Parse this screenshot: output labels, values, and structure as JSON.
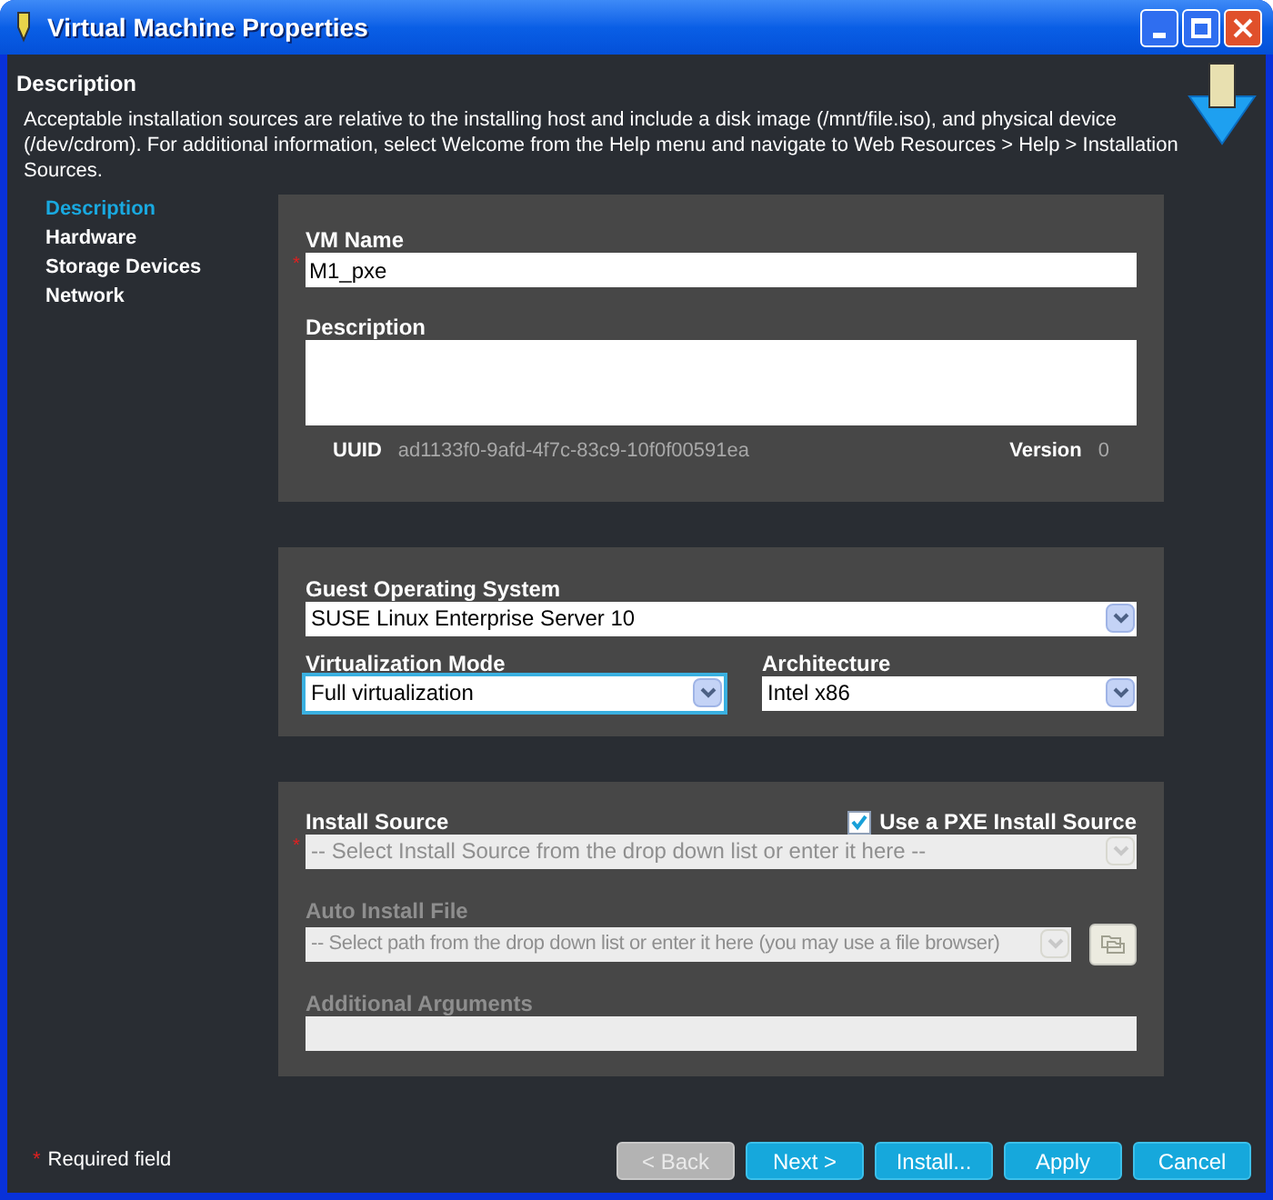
{
  "window": {
    "title": "Virtual Machine Properties"
  },
  "header": {
    "title": "Description",
    "text": "Acceptable installation sources are relative to the installing host and include a disk image (/mnt/file.iso), and physical device (/dev/cdrom). For additional information, select Welcome from the Help menu and navigate to Web Resources > Help > Installation Sources."
  },
  "nav": [
    {
      "label": "Description",
      "selected": true
    },
    {
      "label": "Hardware",
      "selected": false
    },
    {
      "label": "Storage Devices",
      "selected": false
    },
    {
      "label": "Network",
      "selected": false
    }
  ],
  "general": {
    "vm_name": {
      "label": "VM Name",
      "value": "M1_pxe",
      "required_mark": "*"
    },
    "description": {
      "label": "Description"
    },
    "uuid": {
      "label": "UUID",
      "value": "ad1133f0-9afd-4f7c-83c9-10f0f00591ea"
    },
    "version": {
      "label": "Version",
      "value": "0"
    }
  },
  "system": {
    "guest_os": {
      "label": "Guest Operating System",
      "value": "SUSE Linux Enterprise Server 10",
      "focused": false
    },
    "virtualization_mode": {
      "label": "Virtualization Mode",
      "value": "Full virtualization",
      "focused": true
    },
    "architecture": {
      "label": "Architecture",
      "value": "Intel x86",
      "focused": false
    }
  },
  "install": {
    "install_source": {
      "label": "Install Source",
      "placeholder": "-- Select Install Source from the drop down list or enter it here --",
      "required_mark": "*",
      "disabled": true
    },
    "pxe": {
      "label": "Use a PXE Install Source",
      "checked": true
    },
    "auto_install_file": {
      "label": "Auto Install File",
      "placeholder": "-- Select path from the drop down list or enter it here (you may use a file browser)",
      "disabled": true
    },
    "additional_arguments": {
      "label": "Additional Arguments",
      "disabled": true
    }
  },
  "footer": {
    "required_mark": "*",
    "required_text": "Required field",
    "buttons": [
      {
        "label": "< Back",
        "disabled": true
      },
      {
        "label": "Next >",
        "disabled": false
      },
      {
        "label": "Install...",
        "disabled": false
      },
      {
        "label": "Apply",
        "disabled": false
      },
      {
        "label": "Cancel",
        "disabled": false
      }
    ]
  }
}
